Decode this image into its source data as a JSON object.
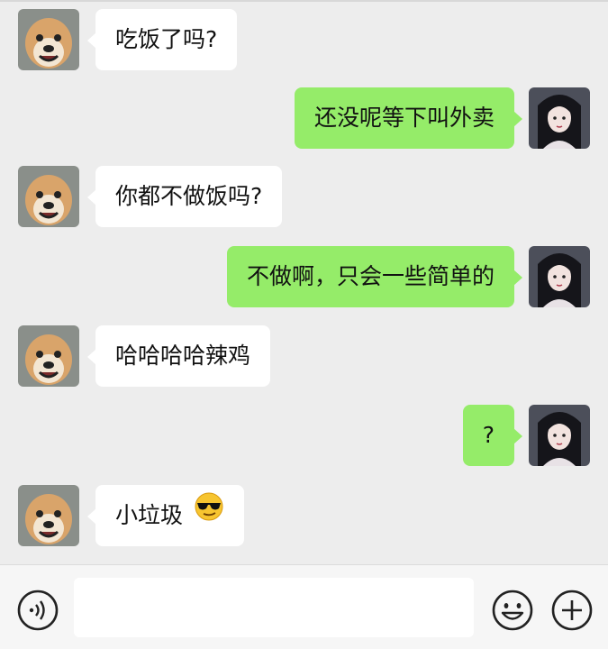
{
  "chat": {
    "messages": [
      {
        "side": "left",
        "text": "吃饭了吗?"
      },
      {
        "side": "right",
        "text": "还没呢等下叫外卖"
      },
      {
        "side": "left",
        "text": "你都不做饭吗?"
      },
      {
        "side": "right",
        "text": "不做啊，只会一些简单的"
      },
      {
        "side": "left",
        "text": "哈哈哈哈辣鸡"
      },
      {
        "side": "right",
        "text": "?"
      },
      {
        "side": "left",
        "text": "小垃圾",
        "emoji": "sunglasses-emoji"
      }
    ]
  },
  "icons": {
    "voice": "voice-icon",
    "emoji": "smiley-icon",
    "plus": "plus-icon"
  },
  "colors": {
    "background": "#ededed",
    "sent_bubble": "#95ec69",
    "received_bubble": "#ffffff"
  },
  "input": {
    "value": ""
  }
}
